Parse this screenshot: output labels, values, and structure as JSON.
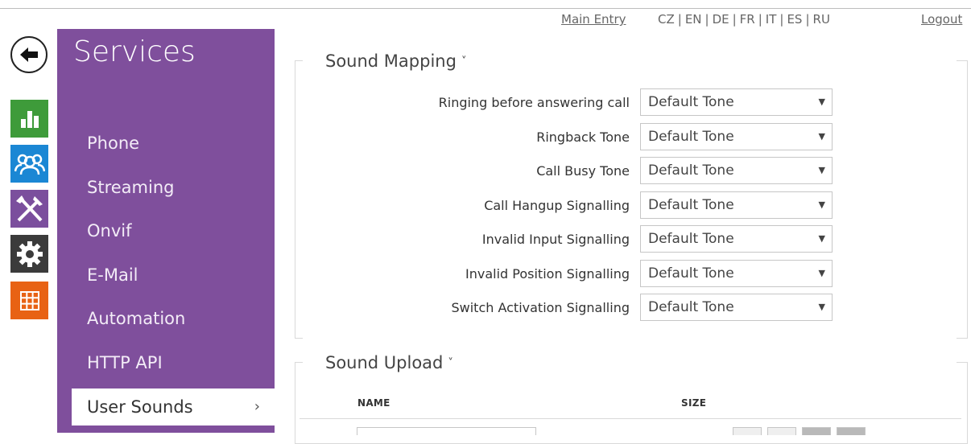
{
  "topbar": {
    "main_entry": "Main Entry",
    "languages": [
      "CZ",
      "EN",
      "DE",
      "FR",
      "IT",
      "ES",
      "RU"
    ],
    "logout": "Logout"
  },
  "nav_icons": [
    "back-arrow-icon",
    "status-chart-icon",
    "directory-users-icon",
    "hardware-tools-icon",
    "system-gear-icon",
    "services-grid-icon"
  ],
  "sidebar": {
    "title": "Services",
    "items": [
      {
        "label": "Phone"
      },
      {
        "label": "Streaming"
      },
      {
        "label": "Onvif"
      },
      {
        "label": "E-Mail"
      },
      {
        "label": "Automation"
      },
      {
        "label": "HTTP API"
      },
      {
        "label": "User Sounds",
        "active": true,
        "chevron": "›"
      }
    ]
  },
  "sound_mapping": {
    "title": "Sound Mapping",
    "caret": "˅",
    "rows": [
      {
        "label": "Ringing before answering call",
        "value": "Default Tone"
      },
      {
        "label": "Ringback Tone",
        "value": "Default Tone"
      },
      {
        "label": "Call Busy Tone",
        "value": "Default Tone"
      },
      {
        "label": "Call Hangup Signalling",
        "value": "Default Tone"
      },
      {
        "label": "Invalid Input Signalling",
        "value": "Default Tone"
      },
      {
        "label": "Invalid Position Signalling",
        "value": "Default Tone"
      },
      {
        "label": "Switch Activation Signalling",
        "value": "Default Tone"
      }
    ]
  },
  "sound_upload": {
    "title": "Sound Upload",
    "caret": "˅",
    "columns": [
      "NAME",
      "SIZE"
    ]
  },
  "colors": {
    "sidebar": "#7f4f9c",
    "status": "#3e9b3a",
    "directory": "#1b87d4",
    "hardware": "#7b4f9d",
    "system": "#3b3b3b",
    "services": "#e86214"
  }
}
